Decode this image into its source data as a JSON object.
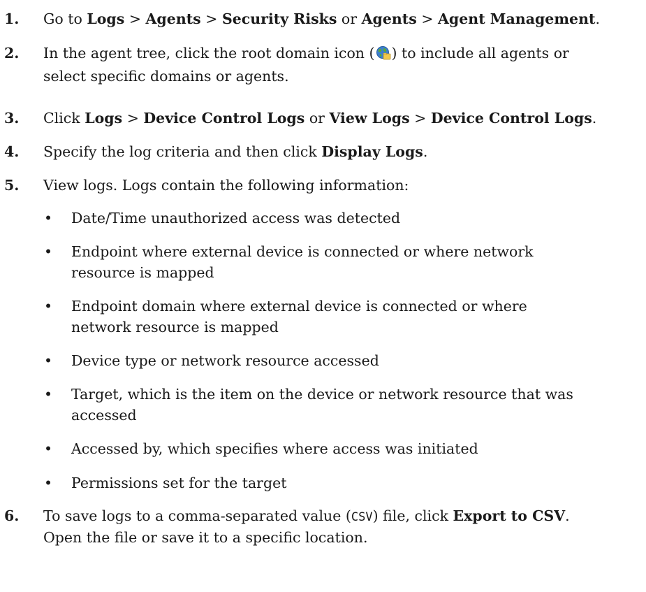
{
  "steps": [
    {
      "number": "1.",
      "parts": [
        {
          "t": "Go to "
        },
        {
          "t": "Logs",
          "b": true
        },
        {
          "t": " > "
        },
        {
          "t": "Agents",
          "b": true
        },
        {
          "t": " > "
        },
        {
          "t": "Security Risks",
          "b": true
        },
        {
          "t": " or "
        },
        {
          "t": "Agents",
          "b": true
        },
        {
          "t": " > "
        },
        {
          "t": "Agent Management",
          "b": true
        },
        {
          "t": "."
        }
      ]
    },
    {
      "number": "2.",
      "line1_before_icon": "In the agent tree, click the root domain icon (",
      "line1_after_icon": ") to include all agents or",
      "line2": "select specific domains or agents.",
      "icon": "root-domain-globe-icon"
    },
    {
      "number": "3.",
      "parts": [
        {
          "t": "Click "
        },
        {
          "t": "Logs",
          "b": true
        },
        {
          "t": " > "
        },
        {
          "t": "Device Control Logs",
          "b": true
        },
        {
          "t": " or "
        },
        {
          "t": "View Logs",
          "b": true
        },
        {
          "t": " > "
        },
        {
          "t": "Device Control Logs",
          "b": true
        },
        {
          "t": "."
        }
      ]
    },
    {
      "number": "4.",
      "parts": [
        {
          "t": "Specify the log criteria and then click "
        },
        {
          "t": "Display Logs",
          "b": true
        },
        {
          "t": "."
        }
      ]
    },
    {
      "number": "5.",
      "text": "View logs. Logs contain the following information:",
      "bullets": [
        {
          "line1": "Date/Time unauthorized access was detected"
        },
        {
          "line1": "Endpoint where external device is connected or where network",
          "line2": "resource is mapped"
        },
        {
          "line1": "Endpoint domain where external device is connected or where",
          "line2": "network resource is mapped"
        },
        {
          "line1": "Device type or network resource accessed"
        },
        {
          "line1": "Target, which is the item on the device or network resource that was",
          "line2": "accessed"
        },
        {
          "line1": "Accessed by, which specifies where access was initiated"
        },
        {
          "line1": "Permissions set for the target"
        }
      ]
    },
    {
      "number": "6.",
      "line1_a": "To save logs to a comma-separated value (",
      "line1_code": "CSV",
      "line1_b": ") file, click ",
      "line1_bold": "Export to CSV",
      "line1_c": ".",
      "line2": "Open the file or save it to a specific location."
    }
  ],
  "bullet_glyph": "•",
  "colors": {
    "text": "#1a1a1a",
    "globe_blue": "#3b7fd0",
    "globe_green": "#5aa83a",
    "folder_yellow": "#f2c94c"
  }
}
